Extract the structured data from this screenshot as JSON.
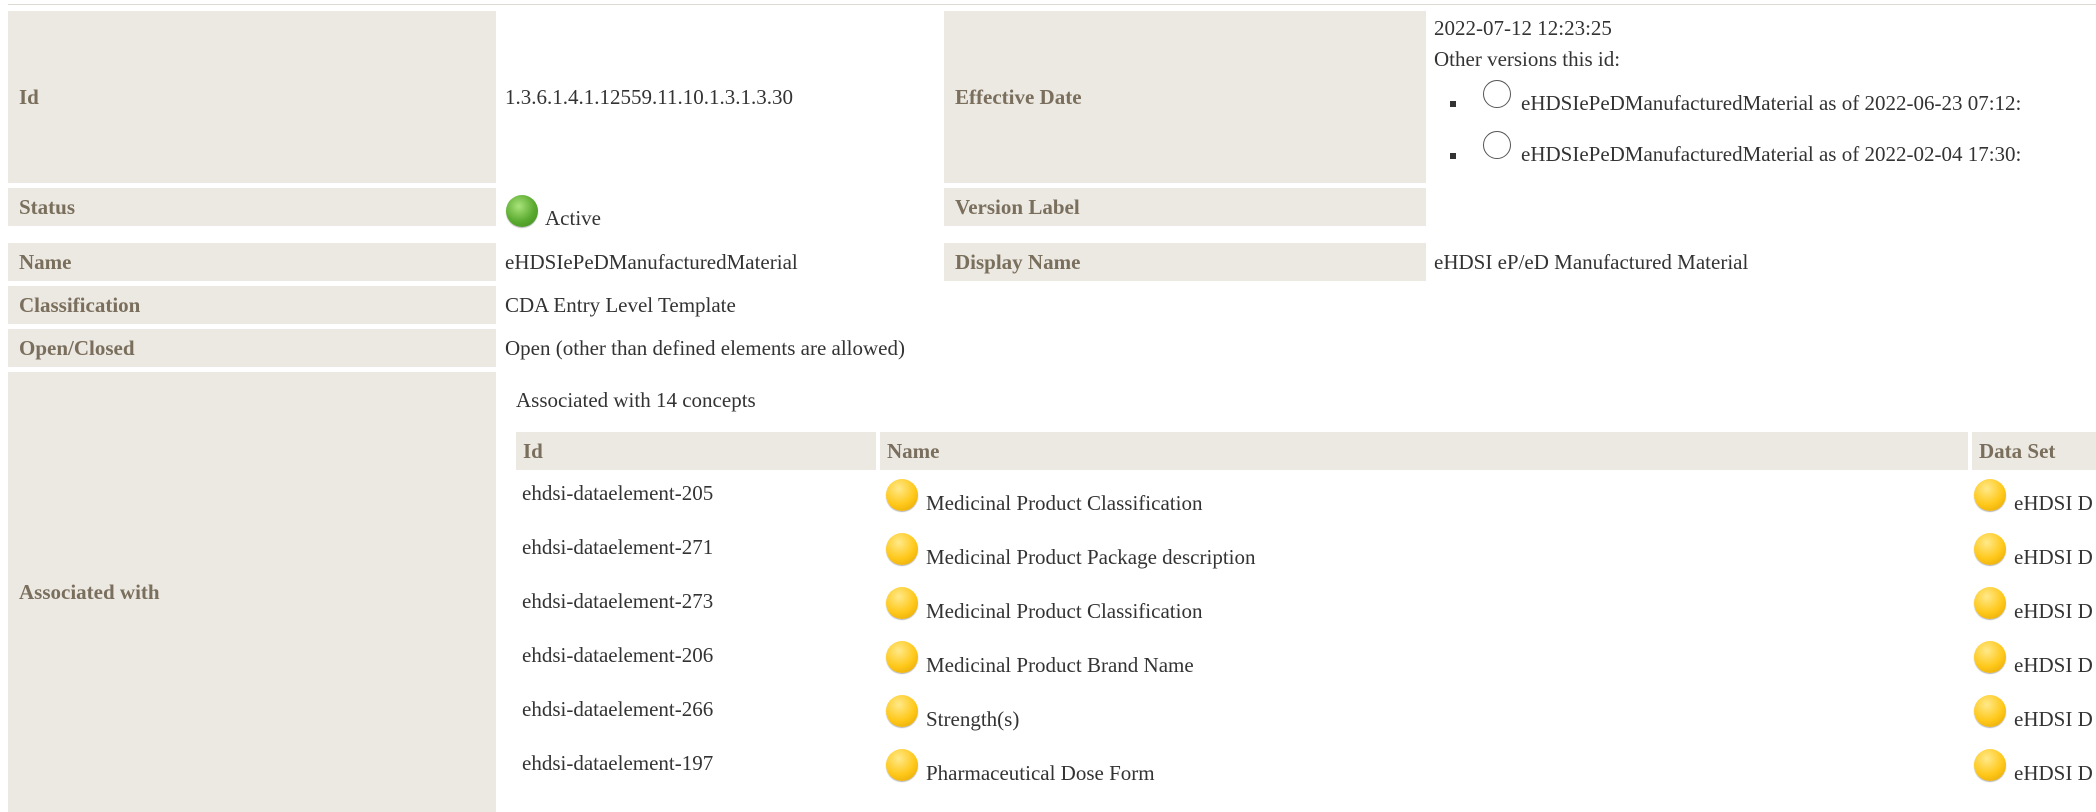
{
  "template": {
    "id_label": "Id",
    "id_value": "1.3.6.1.4.1.12559.11.10.1.3.1.3.30",
    "effective_date_label": "Effective Date",
    "effective_date_value": "2022-07-12 12:23:25",
    "other_versions_label": "Other versions this id:",
    "other_versions": [
      "eHDSIePeDManufacturedMaterial as of 2022-06-23 07:12:",
      "eHDSIePeDManufacturedMaterial as of 2022-02-04 17:30:"
    ],
    "status_label": "Status",
    "status_value": "Active",
    "status_color": "#5aaa30",
    "version_label_label": "Version Label",
    "version_label_value": "",
    "name_label": "Name",
    "name_value": "eHDSIePeDManufacturedMaterial",
    "display_name_label": "Display Name",
    "display_name_value": "eHDSI eP/eD Manufactured Material",
    "classification_label": "Classification",
    "classification_value": "CDA Entry Level Template",
    "open_closed_label": "Open/Closed",
    "open_closed_value": "Open (other than defined elements are allowed)",
    "associated_label": "Associated with",
    "associated_summary": "Associated with 14 concepts"
  },
  "concepts_table": {
    "headers": [
      "Id",
      "Name",
      "Data Set"
    ],
    "draft_color": "#ffc81a",
    "rows": [
      {
        "id": "ehdsi-dataelement-205",
        "name": "Medicinal Product Classification",
        "dataset": "eHDSI D"
      },
      {
        "id": "ehdsi-dataelement-271",
        "name": "Medicinal Product Package description",
        "dataset": "eHDSI D"
      },
      {
        "id": "ehdsi-dataelement-273",
        "name": "Medicinal Product Classification",
        "dataset": "eHDSI D"
      },
      {
        "id": "ehdsi-dataelement-206",
        "name": "Medicinal Product Brand Name",
        "dataset": "eHDSI D"
      },
      {
        "id": "ehdsi-dataelement-266",
        "name": "Strength(s)",
        "dataset": "eHDSI D"
      },
      {
        "id": "ehdsi-dataelement-197",
        "name": "Pharmaceutical Dose Form",
        "dataset": "eHDSI D"
      }
    ]
  }
}
